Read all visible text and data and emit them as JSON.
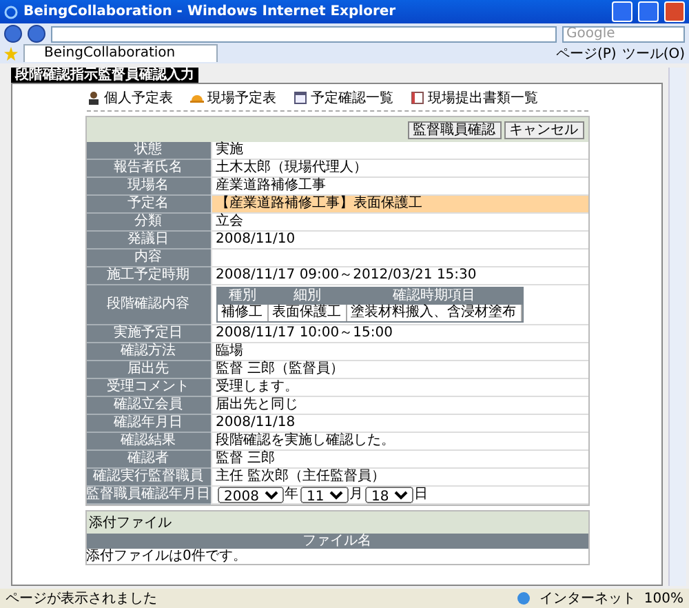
{
  "window": {
    "title": "BeingCollaboration - Windows Internet Explorer"
  },
  "browser": {
    "search_placeholder": "Google",
    "tab": "BeingCollaboration",
    "page_menu": "ページ(P)",
    "tools_menu": "ツール(O)"
  },
  "page": {
    "tab": "段階確認指示監督員確認入力",
    "nav": [
      {
        "label": "個人予定表"
      },
      {
        "label": "現場予定表"
      },
      {
        "label": "予定確認一覧"
      },
      {
        "label": "現場提出書類一覧"
      }
    ],
    "buttons": [
      "監督職員確認",
      "キャンセル"
    ],
    "rows": [
      {
        "kind": "text",
        "label": "状態",
        "value": "実施",
        "highlighted": false
      },
      {
        "kind": "text",
        "label": "報告者氏名",
        "value": "土木太郎（現場代理人）",
        "highlighted": false
      },
      {
        "kind": "text",
        "label": "現場名",
        "value": "産業道路補修工事",
        "highlighted": false
      },
      {
        "kind": "text",
        "label": "予定名",
        "value": "【産業道路補修工事】表面保護工",
        "highlighted": true
      },
      {
        "kind": "text",
        "label": "分類",
        "value": "立会",
        "highlighted": false
      },
      {
        "kind": "text",
        "label": "発議日",
        "value": "2008/11/10",
        "highlighted": false
      },
      {
        "kind": "text",
        "label": "内容",
        "highlighted": false
      },
      {
        "kind": "text",
        "label": "施工予定時期",
        "value": "2008/11/17 09:00～2012/03/21 15:30",
        "highlighted": false
      },
      {
        "kind": "table",
        "label": "段階確認内容",
        "columns": [
          "種別",
          "細別",
          "確認時期項目"
        ],
        "cells": [
          "補修工",
          "表面保護工",
          "塗装材料搬入、含浸材塗布"
        ]
      },
      {
        "kind": "text",
        "label": "実施予定日",
        "value": "2008/11/17 10:00～15:00",
        "highlighted": false
      },
      {
        "kind": "text",
        "label": "確認方法",
        "value": "臨場",
        "highlighted": false
      },
      {
        "kind": "text",
        "label": "届出先",
        "value": "監督 三郎（監督員）",
        "highlighted": false
      },
      {
        "kind": "text",
        "label": "受理コメント",
        "value": "受理します。",
        "highlighted": false
      },
      {
        "kind": "text",
        "label": "確認立会員",
        "value": "届出先と同じ",
        "highlighted": false
      },
      {
        "kind": "text",
        "label": "確認年月日",
        "value": "2008/11/18",
        "highlighted": false
      },
      {
        "kind": "text",
        "label": "確認結果",
        "value": "段階確認を実施し確認した。",
        "highlighted": false
      },
      {
        "kind": "text",
        "label": "確認者",
        "value": "監督 三郎",
        "highlighted": false
      },
      {
        "kind": "text",
        "label": "確認実行監督職員",
        "value": "主任 監次郎（主任監督員）",
        "highlighted": false
      },
      {
        "kind": "date",
        "label": "監督職員確認年月日",
        "parts": [
          {
            "value": "2008",
            "unit": "年"
          },
          {
            "value": "11",
            "unit": "月"
          },
          {
            "value": "18",
            "unit": "日"
          }
        ]
      }
    ],
    "attachments": {
      "title": "添付ファイル",
      "column": "ファイル名",
      "empty": "添付ファイルは0件です。"
    }
  },
  "status_bar": {
    "message": "ページが表示されました",
    "zone": "インターネット",
    "zoom": "100%"
  }
}
